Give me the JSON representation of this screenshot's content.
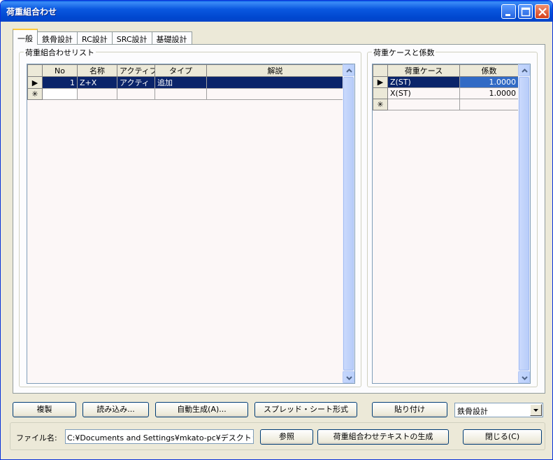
{
  "window": {
    "title": "荷重組合わせ"
  },
  "tabs": [
    "一般",
    "鉄骨設計",
    "RC設計",
    "SRC設計",
    "基礎設計"
  ],
  "combo_list": {
    "group_label": "荷重組合わせリスト",
    "columns": [
      "No",
      "名称",
      "アクティブ",
      "タイプ",
      "解説"
    ],
    "rows": [
      {
        "no": "1",
        "name": "Z+X",
        "active": "アクティ",
        "type": "追加",
        "desc": ""
      }
    ]
  },
  "case_list": {
    "group_label": "荷重ケースと係数",
    "columns": [
      "荷重ケース",
      "係数"
    ],
    "rows": [
      {
        "case": "Z(ST)",
        "factor": "1.0000"
      },
      {
        "case": "X(ST)",
        "factor": "1.0000"
      }
    ]
  },
  "buttons": {
    "duplicate": "複製",
    "load": "読み込み...",
    "auto_generate": "自動生成(A)...",
    "spreadsheet": "スプレッド・シート形式",
    "paste": "貼り付け",
    "browse": "参照",
    "generate_text": "荷重組合わせテキストの生成",
    "close": "閉じる(C)"
  },
  "design_select": {
    "value": "鉄骨設計"
  },
  "file": {
    "label": "ファイル名:",
    "path": "C:¥Documents and Settings¥mkato-pc¥デスクトップ¥m"
  },
  "row_markers": {
    "current": "▶",
    "new": "✳"
  }
}
